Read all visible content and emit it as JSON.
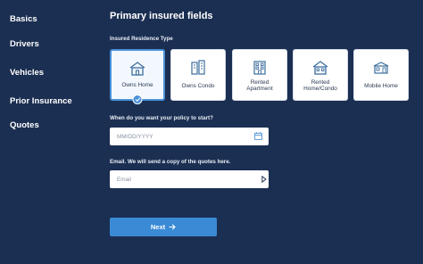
{
  "sidebar": {
    "items": [
      {
        "label": "Basics"
      },
      {
        "label": "Drivers"
      },
      {
        "label": "Vehicles"
      },
      {
        "label": "Prior Insurance"
      },
      {
        "label": "Quotes"
      }
    ]
  },
  "main": {
    "title": "Primary insured fields",
    "residence_label": "Insured Residence Type",
    "residence_options": [
      {
        "label": "Owns Home",
        "icon": "house-icon",
        "selected": true
      },
      {
        "label": "Owns Condo",
        "icon": "condo-icon",
        "selected": false
      },
      {
        "label": "Rented Apartment",
        "line1": "Rented",
        "line2": "Apartment",
        "icon": "apartment-icon",
        "selected": false
      },
      {
        "label": "Rented Home/Condo",
        "line1": "Rented",
        "line2": "Home/Condo",
        "icon": "rented-home-icon",
        "selected": false
      },
      {
        "label": "Mobile Home",
        "icon": "mobile-home-icon",
        "selected": false
      }
    ],
    "start_date_label": "When do you want your policy to start?",
    "start_date_placeholder": "MM/DD/YYYY",
    "email_label": "Email. We will send a copy of the quotes here.",
    "email_placeholder": "Email",
    "next_label": "Next"
  },
  "colors": {
    "background": "#1b2f52",
    "accent": "#3b8ad6",
    "icon_stroke": "#3d6e9e"
  }
}
